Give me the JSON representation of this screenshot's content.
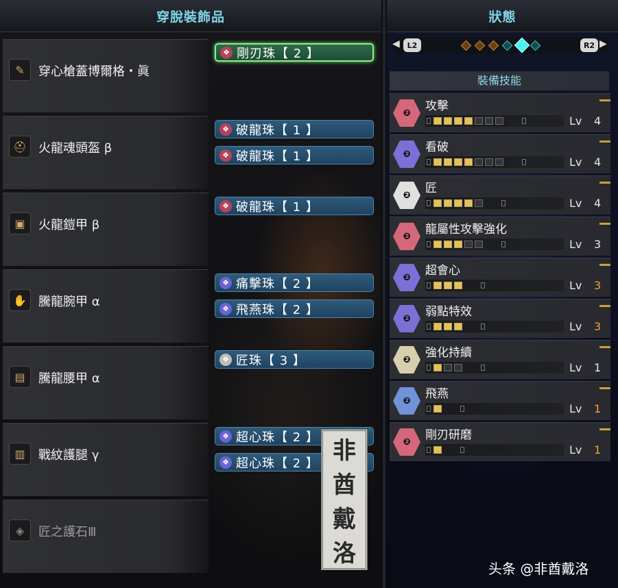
{
  "left_panel": {
    "title": "穿脫裝飾品",
    "equipment": [
      {
        "name": "穿心槍蓋博爾格・眞",
        "icon": "lance-weapon-icon",
        "decorations": [
          {
            "label": "剛刃珠【 2 】",
            "active": true
          }
        ]
      },
      {
        "name": "火龍魂頭盔 β",
        "icon": "helmet-icon",
        "decorations": [
          {
            "label": "破龍珠【 1 】"
          },
          {
            "label": "破龍珠【 1 】"
          }
        ]
      },
      {
        "name": "火龍鎧甲 β",
        "icon": "chest-armor-icon",
        "decorations": [
          {
            "label": "破龍珠【 1 】"
          }
        ]
      },
      {
        "name": "騰龍腕甲 α",
        "icon": "gauntlet-icon",
        "decorations": [
          {
            "label": "痛擊珠【 2 】"
          },
          {
            "label": "飛燕珠【 2 】"
          }
        ]
      },
      {
        "name": "騰龍腰甲 α",
        "icon": "waist-armor-icon",
        "decorations": [
          {
            "label": "匠珠【 3 】"
          }
        ]
      },
      {
        "name": "戰紋護腿 γ",
        "icon": "leg-armor-icon",
        "decorations": [
          {
            "label": "超心珠【 2 】"
          },
          {
            "label": "超心珠【 2 】"
          }
        ]
      },
      {
        "name": "匠之護石Ⅲ",
        "icon": "charm-icon",
        "decorations": [],
        "dim": true
      }
    ]
  },
  "right_panel": {
    "title": "狀態",
    "left_trigger": "L2",
    "right_trigger": "R2",
    "skills_header": "裝備技能",
    "lv_label": "Lv",
    "skills": [
      {
        "name": "攻擊",
        "level": "4",
        "max": 7,
        "color": "#d4687a",
        "highlight": false
      },
      {
        "name": "看破",
        "level": "4",
        "max": 7,
        "color": "#7c6fd6",
        "highlight": false
      },
      {
        "name": "匠",
        "level": "4",
        "max": 5,
        "color": "#e0e0e0",
        "highlight": false
      },
      {
        "name": "龍屬性攻擊強化",
        "level": "3",
        "max": 5,
        "color": "#d4687a",
        "highlight": false
      },
      {
        "name": "超會心",
        "level": "3",
        "max": 3,
        "color": "#7c6fd6",
        "highlight": true
      },
      {
        "name": "弱點特效",
        "level": "3",
        "max": 3,
        "color": "#7c6fd6",
        "highlight": true
      },
      {
        "name": "強化持續",
        "level": "1",
        "max": 3,
        "color": "#d8cfae",
        "highlight": false
      },
      {
        "name": "飛燕",
        "level": "1",
        "max": 1,
        "color": "#6f92d8",
        "highlight": true
      },
      {
        "name": "剛刃研磨",
        "level": "1",
        "max": 1,
        "color": "#d4687a",
        "highlight": true
      }
    ]
  },
  "seal_chars": [
    "非",
    "酋",
    "戴",
    "洛"
  ],
  "watermark": "头条 @非酋戴洛"
}
